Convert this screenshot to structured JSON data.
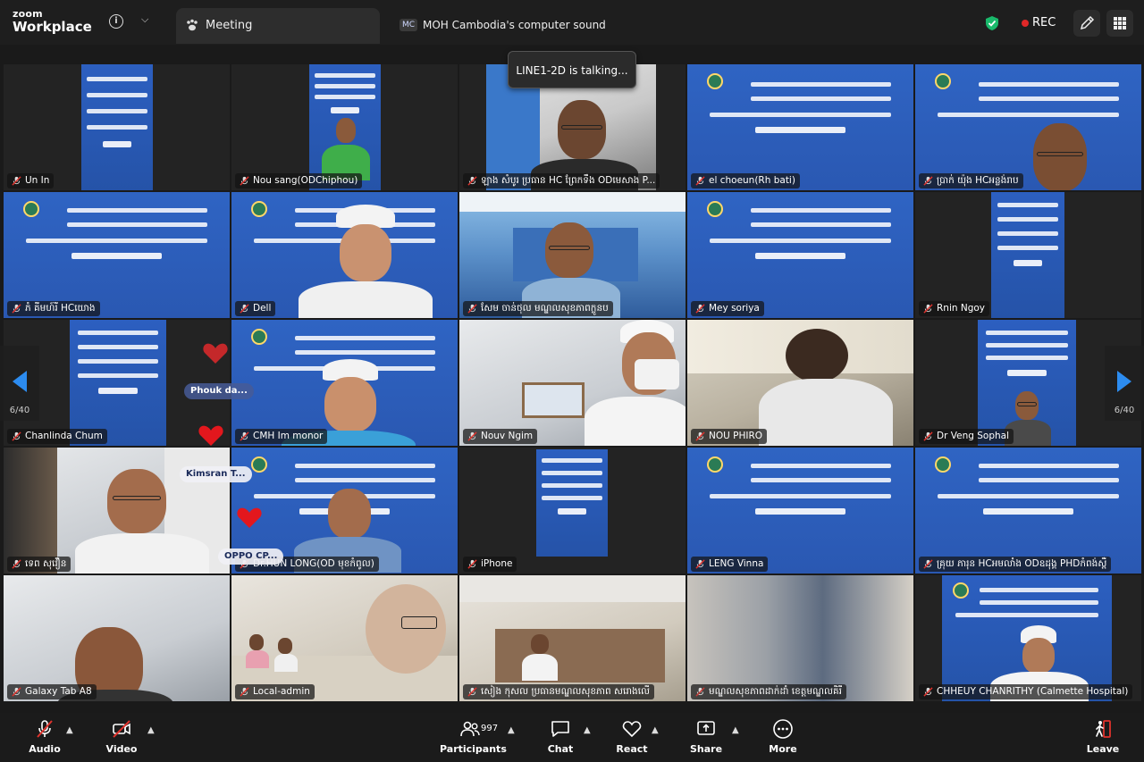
{
  "app": {
    "brand_line1": "zoom",
    "brand_line2": "Workplace"
  },
  "tabs": {
    "meeting": "Meeting",
    "sound_abbr": "MC",
    "sound": "MOH Cambodia's computer sound"
  },
  "status": {
    "rec": "REC",
    "talking": "LINE1-2D is talking...",
    "page_left": "6/40",
    "page_right": "6/40"
  },
  "chips": {
    "phouk": "Phouk da...",
    "kimsran": "Kimsran T...",
    "oppo": "OPPO CP..."
  },
  "tiles": [
    {
      "name": "Un In"
    },
    {
      "name": "Nou sang(ODChiphou)"
    },
    {
      "name": "ឡាង សំបូរ ប្រធាន HC ព្រែកទឹង ODមេសាង P..."
    },
    {
      "name": "el choeun(Rh bati)"
    },
    {
      "name": "ប្រាក់ យ៉ុង HCអន្លង់រាប"
    },
    {
      "name": "ភំ គីមហ៍រី HCយោង"
    },
    {
      "name": "Dell"
    },
    {
      "name": "សែម ចាន់ថុល មណ្ឌលសុខភាពក្លូនប"
    },
    {
      "name": "Mey soriya"
    },
    {
      "name": "Rnin Ngoy"
    },
    {
      "name": "Chanlinda Chum"
    },
    {
      "name": "CMH Im monor"
    },
    {
      "name": "Nouv Ngim"
    },
    {
      "name": "NOU PHIRO"
    },
    {
      "name": "Dr Veng Sophal"
    },
    {
      "name": "ទេព សុវឿន"
    },
    {
      "name": "Dr.HUN LONG(OD មុខកំពូល)"
    },
    {
      "name": "iPhone"
    },
    {
      "name": "LENG Vinna"
    },
    {
      "name": "គ្រុយ ភារុន HCអមលាំង ODឧដុង្គ PHDកំពង់ស្ពឺ"
    },
    {
      "name": "Galaxy Tab A8"
    },
    {
      "name": "Local-admin"
    },
    {
      "name": "សៀង កុសល ប្រធានមណ្ឌលសុខភាព សរោងលើ"
    },
    {
      "name": "មណ្ឌលសុខភាពដាក់ដាំ ខេត្តមណ្ឌលគិរី"
    },
    {
      "name": "CHHEUY CHANRITHY (Calmette Hospital)"
    }
  ],
  "toolbar": {
    "audio": "Audio",
    "video": "Video",
    "participants": "Participants",
    "participants_count": "997",
    "chat": "Chat",
    "react": "React",
    "share": "Share",
    "more": "More",
    "leave": "Leave"
  },
  "colors": {
    "accent_blue": "#2e62c0",
    "rec_red": "#e02828",
    "shield_green": "#19b96b",
    "mute_red": "#e0322c"
  }
}
